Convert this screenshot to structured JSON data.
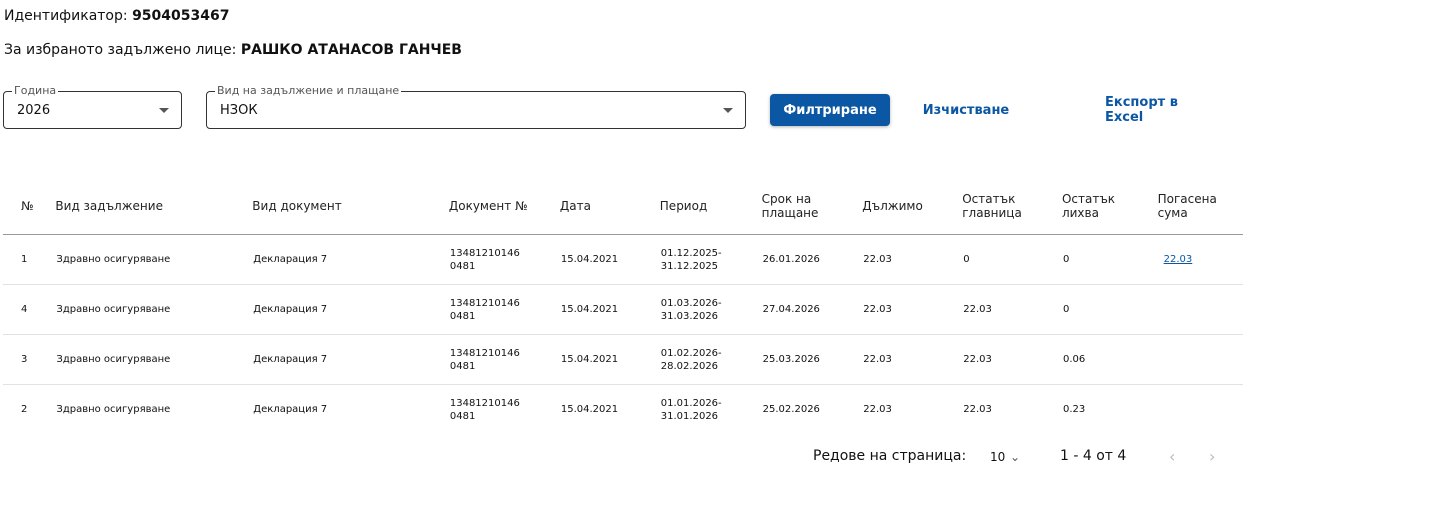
{
  "header": {
    "id_label": "Идентификатор: ",
    "id_value": "9504053467",
    "person_label": "За избраното задължено лице: ",
    "person_value": "РАШКО АТАНАСОВ ГАНЧЕВ"
  },
  "filters": {
    "year_label": "Година",
    "year_value": "2026",
    "type_label": "Вид на задължение и плащане",
    "type_value": "НЗОК",
    "filter_button": "Филтриране",
    "clear_button": "Изчистване",
    "export_button": "Експорт в Excel"
  },
  "table": {
    "columns": [
      "№",
      "Вид задължение",
      "Вид документ",
      "Документ №",
      "Дата",
      "Период",
      "Срок на плащане",
      "Дължимо",
      "Остатък главница",
      "Остатък лихва",
      "Погасена сума"
    ],
    "rows": [
      {
        "no": "1",
        "obligation": "Здравно осигуряване",
        "doc_type": "Декларация 7",
        "doc_no": "13481210146 0481",
        "date": "15.04.2021",
        "period": "01.12.2025-31.12.2025",
        "due": "26.01.2026",
        "owed": "22.03",
        "principal": "0",
        "interest": "0",
        "paid": "22.03"
      },
      {
        "no": "4",
        "obligation": "Здравно осигуряване",
        "doc_type": "Декларация 7",
        "doc_no": "13481210146 0481",
        "date": "15.04.2021",
        "period": "01.03.2026-31.03.2026",
        "due": "27.04.2026",
        "owed": "22.03",
        "principal": "22.03",
        "interest": "0",
        "paid": ""
      },
      {
        "no": "3",
        "obligation": "Здравно осигуряване",
        "doc_type": "Декларация 7",
        "doc_no": "13481210146 0481",
        "date": "15.04.2021",
        "period": "01.02.2026-28.02.2026",
        "due": "25.03.2026",
        "owed": "22.03",
        "principal": "22.03",
        "interest": "0.06",
        "paid": ""
      },
      {
        "no": "2",
        "obligation": "Здравно осигуряване",
        "doc_type": "Декларация 7",
        "doc_no": "13481210146 0481",
        "date": "15.04.2021",
        "period": "01.01.2026-31.01.2026",
        "due": "25.02.2026",
        "owed": "22.03",
        "principal": "22.03",
        "interest": "0.23",
        "paid": ""
      }
    ]
  },
  "pagination": {
    "rows_per_page_label": "Редове на страница:",
    "rows_per_page_value": "10",
    "range_text": "1 - 4 от 4"
  },
  "icons": {
    "dropdown": "triangle-down-icon",
    "rpp_chevron": "chevron-down-icon",
    "prev": "chevron-left-icon",
    "next": "chevron-right-icon"
  },
  "colors": {
    "accent": "#0b57a4"
  }
}
